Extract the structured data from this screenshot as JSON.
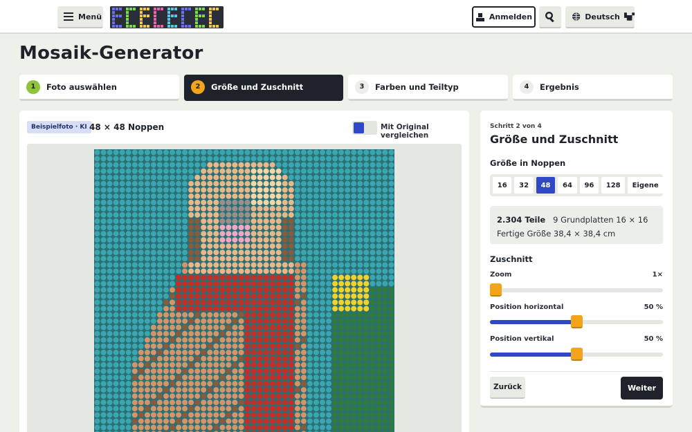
{
  "header": {
    "menu_label": "Menü",
    "logo_text": "BRICORIA",
    "login_label": "Anmelden",
    "language_label": "Deutsch",
    "icons": {
      "menu": "hamburger-icon",
      "login": "user-icon",
      "search": "search-icon",
      "language": "globe-icon",
      "chevron": "chevron-down-icon"
    }
  },
  "page_title": "Mosaik-Generator",
  "steps": [
    {
      "number": "1",
      "label": "Foto auswählen",
      "state": "done"
    },
    {
      "number": "2",
      "label": "Größe und Zuschnitt",
      "state": "active"
    },
    {
      "number": "3",
      "label": "Farben und Teiltyp",
      "state": "todo"
    },
    {
      "number": "4",
      "label": "Ergebnis",
      "state": "todo"
    }
  ],
  "preview": {
    "badge": "Beispielfoto · KI",
    "studs_label": "48 × 48 Noppen",
    "compare_label": "Mit Original vergleichen",
    "compare_on": false
  },
  "panel": {
    "kicker": "Schritt 2 von 4",
    "title": "Größe und Zuschnitt",
    "size_heading": "Größe in Noppen",
    "sizes": [
      "16",
      "32",
      "48",
      "64",
      "96",
      "128",
      "Eigene"
    ],
    "selected_size": "48",
    "pieces": "2.304 Teile",
    "plates": "9 Grundplatten 16 × 16",
    "finished_size": "Fertige Größe 38,4 × 38,4 cm",
    "crop_heading": "Zuschnitt",
    "zoom_label": "Zoom",
    "zoom_value": "1×",
    "zoom_fraction": 0,
    "pos_h_label": "Position horizontal",
    "pos_h_value": "50 %",
    "pos_h_fraction": 0.5,
    "pos_v_label": "Position vertikal",
    "pos_v_value": "50 %",
    "pos_v_fraction": 0.5,
    "back_label": "Zurück",
    "next_label": "Weiter"
  },
  "colors": {
    "accent_blue": "#2f49c6",
    "accent_orange": "#f2a51c",
    "dark": "#1e222b",
    "done_green": "#8fc43a"
  }
}
